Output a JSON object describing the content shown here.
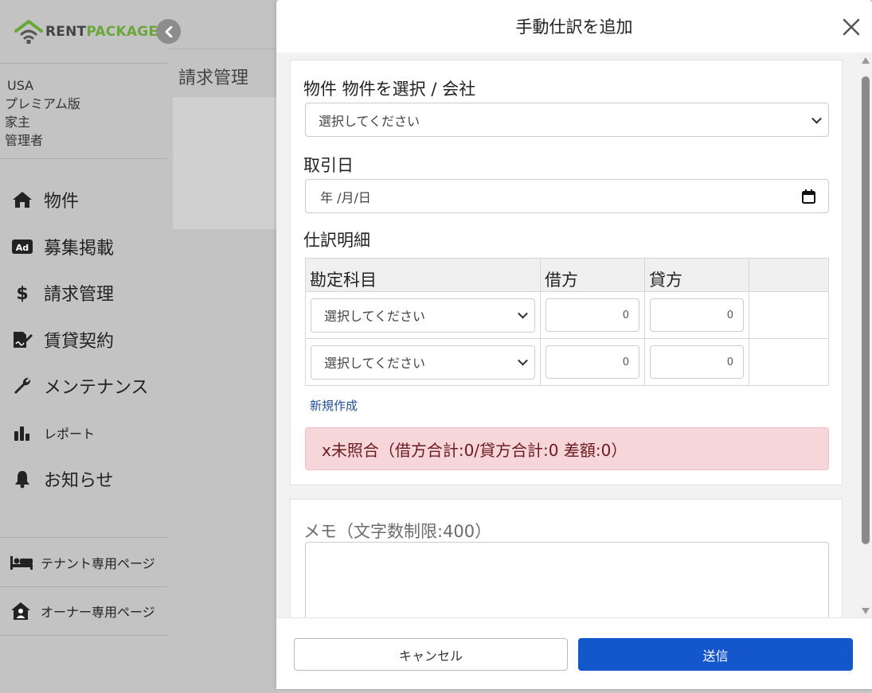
{
  "sidebar": {
    "logo": {
      "text_main": "RENT",
      "text_accent": "PACKAGE",
      "accent_color": "#6aa73a"
    },
    "user": {
      "region": "USA",
      "plan": "プレミアム版",
      "role": "家主",
      "permission": "管理者"
    },
    "items": [
      {
        "label": "物件",
        "icon": "home-icon"
      },
      {
        "label": "募集掲載",
        "icon": "ad-icon"
      },
      {
        "label": "請求管理",
        "icon": "dollar-icon"
      },
      {
        "label": "賃貸契約",
        "icon": "contract-icon"
      },
      {
        "label": "メンテナンス",
        "icon": "wrench-icon"
      },
      {
        "label": "レポート",
        "icon": "bar-chart-icon"
      },
      {
        "label": "お知らせ",
        "icon": "bell-icon"
      }
    ],
    "bottom_links": [
      {
        "label": "テナント専用ページ",
        "icon": "bed-icon"
      },
      {
        "label": "オーナー専用ページ",
        "icon": "house-user-icon"
      }
    ]
  },
  "main": {
    "title": "請求管理"
  },
  "modal": {
    "title": "手動仕訳を追加",
    "property_label": "物件 物件を選択 / 会社",
    "property_select": "選択してください",
    "date_label": "取引日",
    "date_placeholder": "年 /月/日",
    "entries_label": "仕訳明細",
    "table": {
      "headers": [
        "勘定科目",
        "借方",
        "貸方",
        ""
      ],
      "rows": [
        {
          "account": "選択してください",
          "debit": "0",
          "credit": "0"
        },
        {
          "account": "選択してください",
          "debit": "0",
          "credit": "0"
        }
      ]
    },
    "new_link": "新規作成",
    "alert": "x未照合（借方合計:0/貸方合計:0 差額:0）",
    "memo_label": "メモ（文字数制限:400）",
    "cancel_label": "キャンセル",
    "submit_label": "送信",
    "submit_color": "#1456cc"
  }
}
